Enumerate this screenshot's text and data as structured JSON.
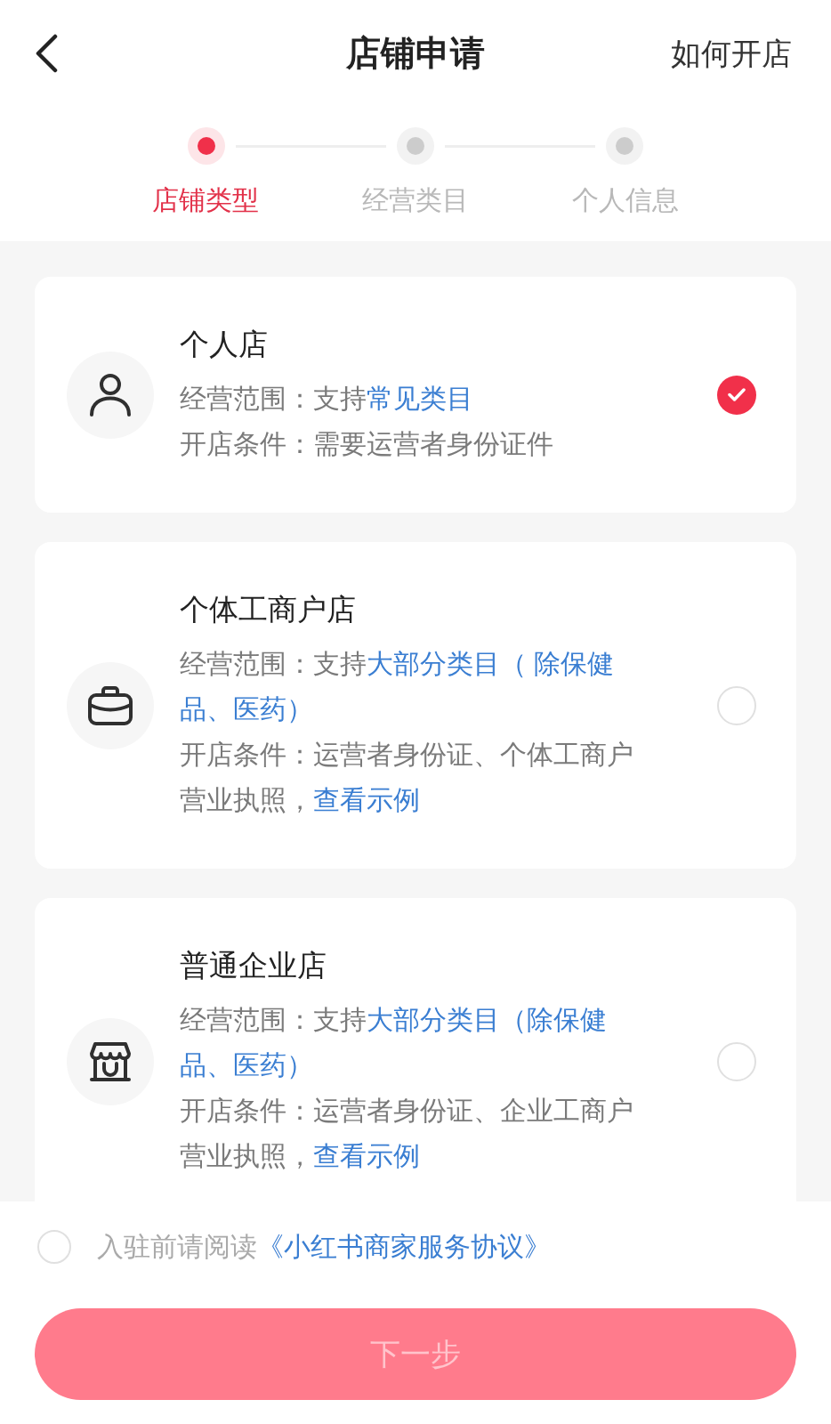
{
  "header": {
    "title": "店铺申请",
    "action": "如何开店"
  },
  "steps": [
    {
      "label": "店铺类型",
      "active": true
    },
    {
      "label": "经营类目",
      "active": false
    },
    {
      "label": "个人信息",
      "active": false
    }
  ],
  "shop_types": [
    {
      "kind": "personal",
      "name": "个人店",
      "selected": true,
      "scope": {
        "text": "经营范围：支持",
        "highlight": "常见类目"
      },
      "requirement": {
        "text": "开店条件：需要运营者身份证件"
      }
    },
    {
      "kind": "sole_proprietor",
      "name": "个体工商户店",
      "selected": false,
      "scope": {
        "text": "经营范围：支持",
        "highlight": "大部分类目（ 除保健品、医药）"
      },
      "requirement": {
        "text": "开店条件：运营者身份证、个体工商户营业执照，",
        "link": "查看示例"
      }
    },
    {
      "kind": "enterprise",
      "name": "普通企业店",
      "selected": false,
      "scope": {
        "text": "经营范围：支持",
        "highlight": "大部分类目（除保健品、医药）"
      },
      "requirement": {
        "text": "开店条件：运营者身份证、企业工商户营业执照，",
        "link": "查看示例"
      }
    }
  ],
  "agreement": {
    "checked": false,
    "text": "入驻前请阅读",
    "link": "《小红书商家服务协议》"
  },
  "next_button": {
    "label": "下一步",
    "disabled": true
  }
}
